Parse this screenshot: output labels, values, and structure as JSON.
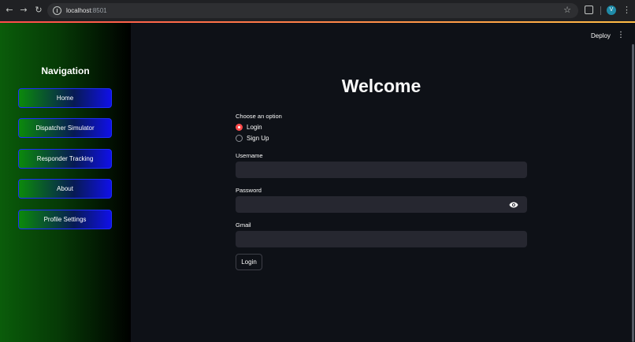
{
  "browser": {
    "url_host": "localhost",
    "url_port": ":8501",
    "profile_initial": "V"
  },
  "header": {
    "deploy_label": "Deploy"
  },
  "sidebar": {
    "title": "Navigation",
    "items": [
      {
        "label": "Home"
      },
      {
        "label": "Dispatcher Simulator"
      },
      {
        "label": "Responder Tracking"
      },
      {
        "label": "About"
      },
      {
        "label": "Profile Settings"
      }
    ]
  },
  "main": {
    "title": "Welcome",
    "option_label": "Choose an option",
    "options": [
      {
        "label": "Login",
        "selected": true
      },
      {
        "label": "Sign Up",
        "selected": false
      }
    ],
    "fields": {
      "username": {
        "label": "Username",
        "value": ""
      },
      "password": {
        "label": "Password",
        "value": ""
      },
      "gmail": {
        "label": "Gmail",
        "value": ""
      }
    },
    "submit_label": "Login"
  },
  "colors": {
    "accent": "#ff4b4b",
    "background": "#0e1117",
    "input_bg": "#262730",
    "nav_button_border": "#1e2cff"
  },
  "icons": {
    "back": "arrow-left-icon",
    "forward": "arrow-right-icon",
    "reload": "reload-icon",
    "site_info": "info-icon",
    "bookmark": "star-icon",
    "extensions": "puzzle-icon",
    "menu": "kebab-menu-icon",
    "password_toggle": "eye-icon"
  }
}
